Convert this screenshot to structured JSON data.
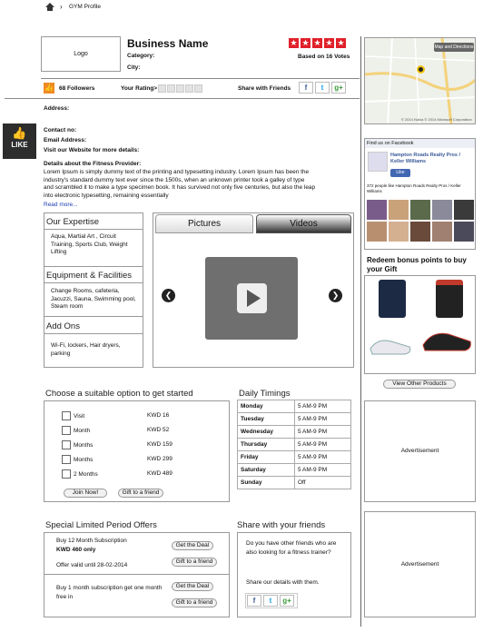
{
  "breadcrumb": {
    "page": "GYM Profile"
  },
  "business": {
    "logo": "Logo",
    "name": "Business Name",
    "category_label": "Category:",
    "city_label": "City:",
    "votes": "Based on 16 Votes"
  },
  "bar": {
    "followers": "68 Followers",
    "rating_label": "Your Rating>",
    "share_label": "Share with Friends"
  },
  "info": {
    "address": "Address:",
    "contact": "Contact no:",
    "email": "Email Address:",
    "website": "Visit our Website for more details:",
    "details_title": "Details about the Fitness Provider:",
    "details_text": "Lorem Ipsum is simply dummy text of the printing and typesetting industry. Lorem Ipsum has been the industry's standard dummy text ever since the 1500s, when an unknown printer took a galley of type and scrambled it to make a type specimen book. It has survived not only five centuries, but also the leap into electronic typesetting, remaining essentially",
    "read_more": "Read more..."
  },
  "like": {
    "label": "LIKE"
  },
  "expertise": {
    "title": "Our Expertise",
    "text": "Aqua, Martial Art , Circuit Training, Sports Club, Weight Lifting"
  },
  "equipment": {
    "title": "Equipment & Facilities",
    "text": "Change Rooms, cafeteria, Jacuzzi, Sauna, Swimming pool, Steam room"
  },
  "addons": {
    "title": "Add Ons",
    "text": "Wi-Fi, lockers, Hair dryers, parking"
  },
  "media": {
    "tab_pictures": "Pictures",
    "tab_videos": "Videos"
  },
  "options": {
    "title": "Choose a suitable option to get started",
    "rows": [
      {
        "label": "Visit",
        "price": "KWD 16"
      },
      {
        "label": "Month",
        "price": "KWD 52"
      },
      {
        "label": "Months",
        "price": "KWD 159"
      },
      {
        "label": "Months",
        "price": "KWD 299"
      },
      {
        "label": "2 Months",
        "price": "KWD 489"
      }
    ],
    "join": "Join Now!",
    "gift": "Gift to a friend"
  },
  "timings": {
    "title": "Daily Timings",
    "rows": [
      {
        "day": "Monday",
        "time": "5 AM-9 PM"
      },
      {
        "day": "Tuesday",
        "time": "5 AM-9 PM"
      },
      {
        "day": "Wednesday",
        "time": "5 AM-9 PM"
      },
      {
        "day": "Thursday",
        "time": "5 AM-9 PM"
      },
      {
        "day": "Friday",
        "time": "5 AM-9 PM"
      },
      {
        "day": "Saturday",
        "time": "5 AM-9 PM"
      },
      {
        "day": "Sunday",
        "time": "Off"
      }
    ]
  },
  "offers": {
    "title": "Special Limited Period Offers",
    "o1_title": "Buy 12 Month Subscription",
    "o1_price": "KWD 460 only",
    "o1_valid": "Offer valid until 28-02-2014",
    "o2_title": "Buy 1 month subscription get one month free in",
    "get_deal": "Get the Deal",
    "gift": "Gift to a friend"
  },
  "share": {
    "title": "Share with your friends",
    "question": "Do you have other friends who are also looking for a fitness trainer?",
    "cta": "Share our details with them."
  },
  "map": {
    "button": "Map and Directions",
    "footer": "© 2014 Nokia  © 2014 Microsoft Corporation"
  },
  "facebook": {
    "header": "Find us on Facebook",
    "page_name": "Hampton Roads Realty Pros / Keller Williams",
    "like": "Like",
    "people": "372 people like Hampton Roads Realty Pros / Keller Williams"
  },
  "bonus": {
    "title": "Redeem bonus points to buy your Gift",
    "view": "View Other Products"
  },
  "ads": {
    "ad1": "Advertisement",
    "ad2": "Advertisement"
  }
}
